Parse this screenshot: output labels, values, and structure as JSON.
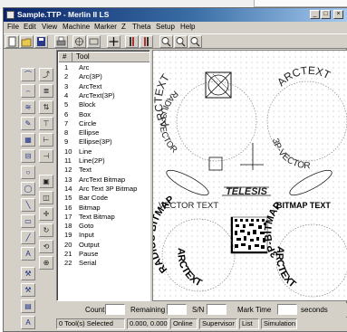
{
  "window": {
    "title": "Sample.TTP - Merlin II LS",
    "controls": [
      "_",
      "□",
      "×"
    ]
  },
  "menu": [
    "File",
    "Edit",
    "View",
    "Machine",
    "Marker",
    "Z",
    "Theta",
    "Setup",
    "Help"
  ],
  "toolbar_icons": [
    "new-file-icon",
    "open-folder-icon",
    "save-icon",
    "print-icon",
    "target-icon",
    "rectangle-icon",
    "move-icon",
    "column-left-icon",
    "column-right-icon",
    "zoom-in-icon",
    "zoom-out-icon",
    "zoom-fit-icon"
  ],
  "left_col1_icons": [
    "arc-icon",
    "arc-up-icon",
    "text-tool-icon",
    "edit-icon",
    "fill-icon",
    "cut-icon",
    "copy-icon",
    "paste-icon",
    "align-icon",
    "rotate-icon",
    "line-icon",
    "text-a-icon",
    "tool-icon",
    "tool2-icon",
    "grid-icon",
    "letter-a-icon"
  ],
  "left_col2_icons": [
    "curve-icon",
    "text-stack-icon",
    "sort-icon",
    "align-top-icon",
    "distribute-icon",
    "mirror-icon",
    "group-icon",
    "ungroup-icon",
    "crosshair-icon",
    "rotate-cw-icon",
    "undo-icon",
    "merge-icon"
  ],
  "tool_list": {
    "headers": [
      "#",
      "Tool"
    ],
    "rows": [
      {
        "num": "1",
        "name": "Arc"
      },
      {
        "num": "2",
        "name": "Arc(3P)"
      },
      {
        "num": "3",
        "name": "ArcText"
      },
      {
        "num": "4",
        "name": "ArcText(3P)"
      },
      {
        "num": "5",
        "name": "Block"
      },
      {
        "num": "6",
        "name": "Box"
      },
      {
        "num": "7",
        "name": "Circle"
      },
      {
        "num": "8",
        "name": "Ellipse"
      },
      {
        "num": "9",
        "name": "Ellipse(3P)"
      },
      {
        "num": "10",
        "name": "Line"
      },
      {
        "num": "11",
        "name": "Line(2P)"
      },
      {
        "num": "12",
        "name": "Text"
      },
      {
        "num": "13",
        "name": "ArcText Bitmap"
      },
      {
        "num": "14",
        "name": "Arc Text 3P Bitmap"
      },
      {
        "num": "15",
        "name": "Bar Code"
      },
      {
        "num": "16",
        "name": "Bitmap"
      },
      {
        "num": "17",
        "name": "Text Bitmap"
      },
      {
        "num": "18",
        "name": "Goto"
      },
      {
        "num": "19",
        "name": "Input"
      },
      {
        "num": "20",
        "name": "Output"
      },
      {
        "num": "21",
        "name": "Pause"
      },
      {
        "num": "22",
        "name": "Serial"
      }
    ]
  },
  "canvas": {
    "arc_text_1": "ARCTEXT",
    "arc_text_2": "RADIUS-VECTOR",
    "arc_text_3": "ARCTEXT",
    "arc_text_4": "3P-VECTOR",
    "text_vector": "VECTOR TEXT",
    "text_bitmap": "BITMAP TEXT",
    "text_telesis": "TELESIS",
    "arc_bitmap_1": "RADIUS BITMAP",
    "arc_bitmap_2": "ARCTEXT",
    "arc_bitmap_3": "3P-BITMAP",
    "arc_bitmap_4": "ARCTEXT"
  },
  "status": {
    "count_label": "Count",
    "remaining_label": "Remaining",
    "sn_label": "S/N",
    "mark_time_label": "Mark Time",
    "seconds_label": "seconds",
    "selected": "0 Tool(s) Selected",
    "coords": "0.000, 0.000",
    "online": "Online",
    "supervisor": "Supervisor",
    "list": "List",
    "simulation": "Simulation"
  },
  "colors": {
    "title_start": "#0a246a",
    "title_end": "#a6caf0",
    "face": "#d4d0c8",
    "icon_blue": "#1c2f7a"
  }
}
